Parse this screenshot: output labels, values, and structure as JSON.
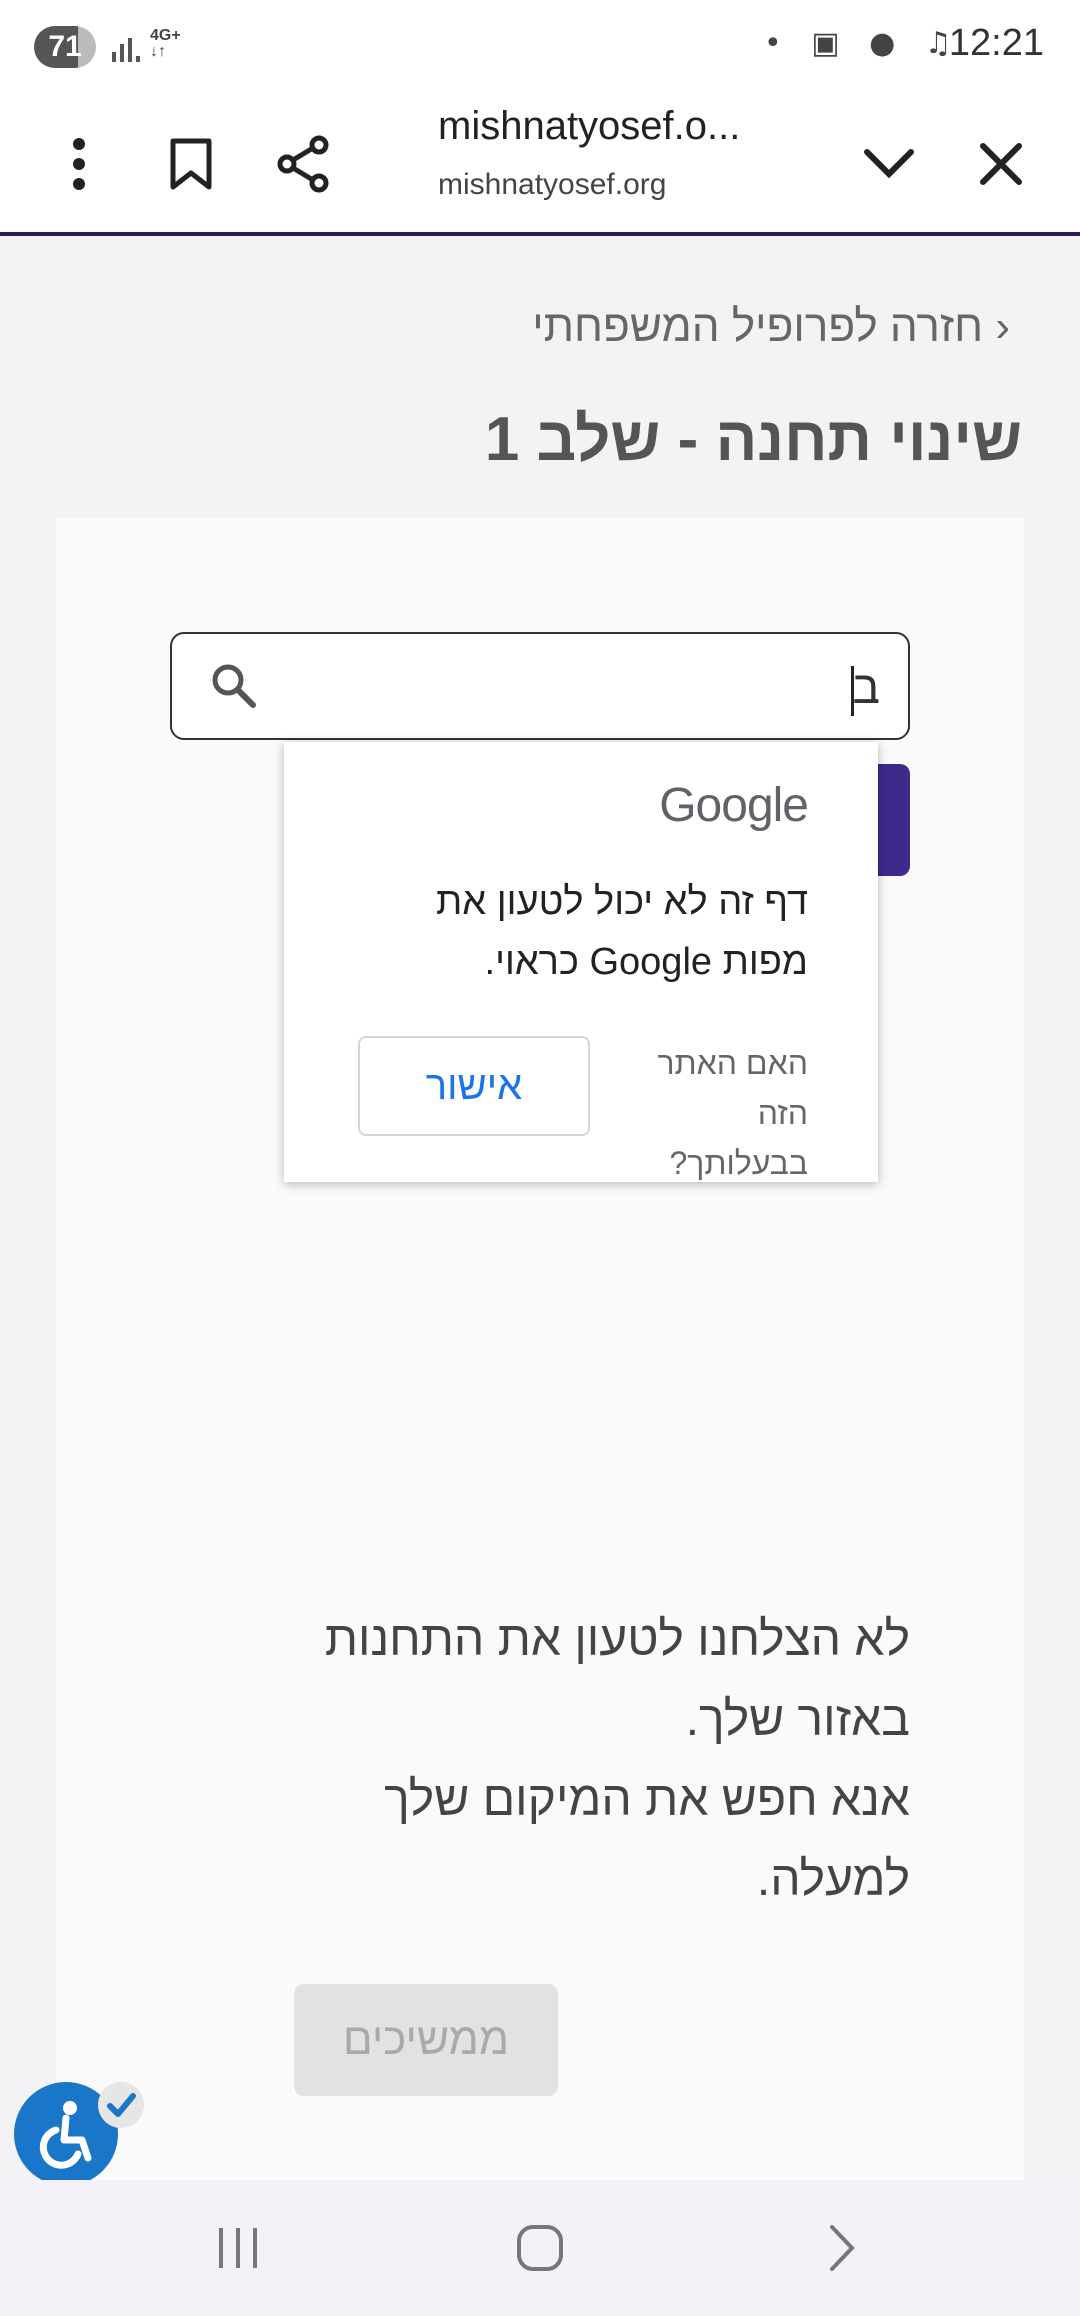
{
  "status_bar": {
    "battery": "71",
    "network": "4G+",
    "time": "12:21"
  },
  "browser": {
    "page_title": "mishnatyosef.o...",
    "domain": "mishnatyosef.org"
  },
  "page": {
    "back_link": "‹ חזרה לפרופיל המשפחתי",
    "title": "שינוי תחנה - שלב 1",
    "search": {
      "value": "ב"
    },
    "google_popup": {
      "logo": "Google",
      "message": "דף זה לא יכול לטעון את מפות Google כראוי.",
      "question": "האם האתר הזה בבעלותך?",
      "ok_label": "אישור"
    },
    "info_lines": [
      "לא הצלחנו לטעון את התחנות באזור שלך.",
      "אנא חפש את המיקום שלך למעלה."
    ],
    "continue_label": "ממשיכים"
  },
  "colors": {
    "accent": "#3f2a8c",
    "link_blue": "#1a73e8",
    "a11y_blue": "#1976c9"
  }
}
